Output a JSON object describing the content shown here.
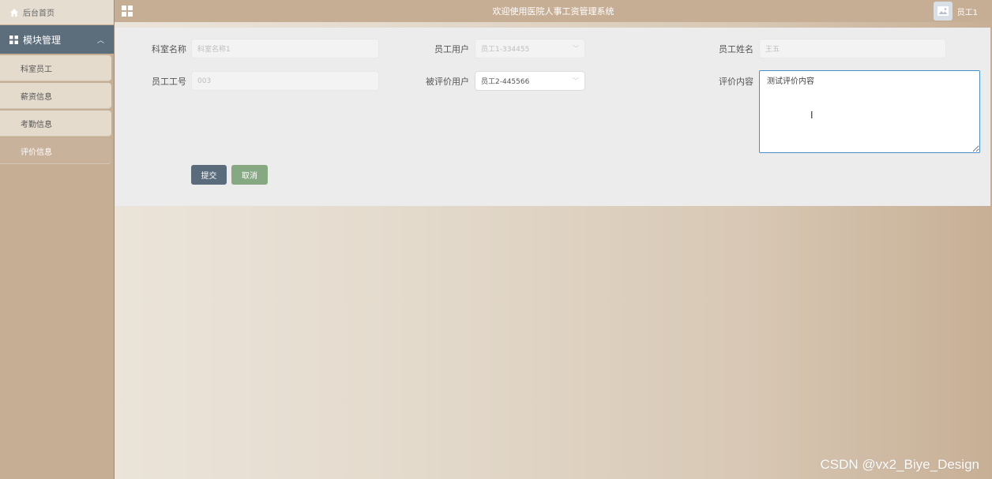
{
  "sidebar": {
    "home_label": "后台首页",
    "module_label": "模块管理",
    "items": [
      {
        "label": "科室员工"
      },
      {
        "label": "薪资信息"
      },
      {
        "label": "考勤信息"
      },
      {
        "label": "评价信息",
        "active": true
      }
    ]
  },
  "topbar": {
    "title": "欢迎使用医院人事工资管理系统",
    "user_name": "员工1"
  },
  "form": {
    "dept_label": "科室名称",
    "dept_placeholder": "科室名称1",
    "emp_user_label": "员工用户",
    "emp_user_value": "员工1-334455",
    "emp_name_label": "员工姓名",
    "emp_name_placeholder": "王五",
    "emp_no_label": "员工工号",
    "emp_no_placeholder": "003",
    "rated_user_label": "被评价用户",
    "rated_user_value": "员工2-445566",
    "content_label": "评价内容",
    "content_value": "测试评价内容",
    "submit_label": "提交",
    "cancel_label": "取消"
  },
  "watermark": "CSDN @vx2_Biye_Design",
  "colors": {
    "sidebar_bg": "#c6ae95",
    "module_header_bg": "#5c6d7b",
    "submit_bg": "#5a6b7b",
    "cancel_bg": "#86a983",
    "textarea_focus_border": "#4a90c8"
  }
}
